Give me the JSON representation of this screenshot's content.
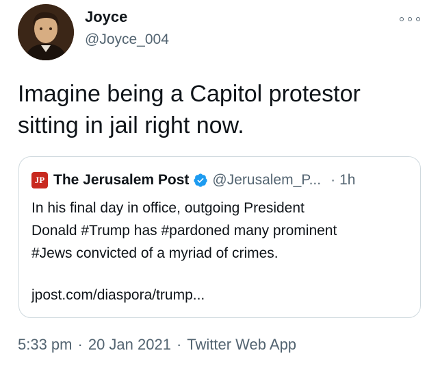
{
  "author": {
    "name": "Joyce",
    "handle": "@Joyce_004",
    "avatar_icon": "portrait-avatar"
  },
  "more_icon": "more-options-icon",
  "tweet": {
    "text_line1": "Imagine being a Capitol protestor",
    "text_line2": "sitting in jail right now."
  },
  "quoted": {
    "logo_text": "JPost",
    "name": "The Jerusalem Post",
    "verified_icon": "verified-badge-icon",
    "handle": "@Jerusalem_P...",
    "separator": "·",
    "time": "1h",
    "text_line1": "In his final day in office, outgoing President",
    "text_line2": "Donald #Trump has #pardoned many prominent",
    "text_line3": "#Jews convicted of a myriad of crimes.",
    "link": "jpost.com/diaspora/trump..."
  },
  "meta": {
    "time": "5:33 pm",
    "date": "20 Jan 2021",
    "source": "Twitter Web App",
    "separator": "·"
  },
  "colors": {
    "text": "#0f1419",
    "secondary": "#536471",
    "verified": "#1d9bf0",
    "border": "#cfd9de",
    "jpost_red": "#c8291f"
  }
}
